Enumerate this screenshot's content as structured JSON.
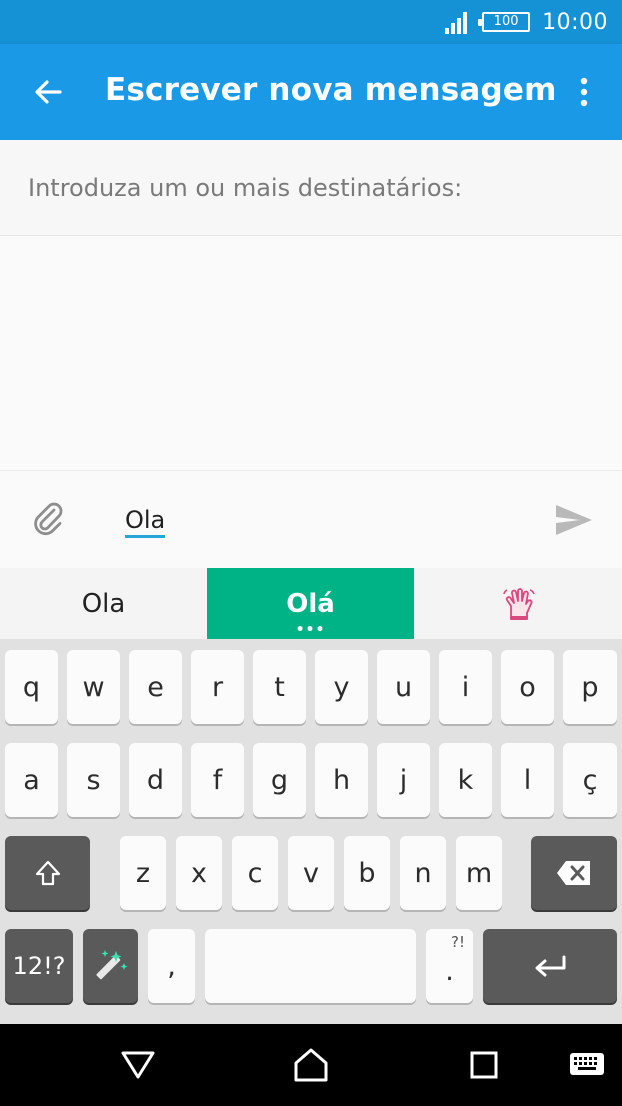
{
  "status_bar": {
    "battery": "100",
    "time": "10:00",
    "icons": [
      "signal-icon",
      "battery-icon"
    ]
  },
  "app_bar": {
    "title": "Escrever nova mensagem",
    "icons": [
      "back-arrow-icon",
      "more-vert-icon"
    ]
  },
  "recipients": {
    "placeholder": "Introduza um ou mais destinatários:"
  },
  "compose": {
    "message_text": "Ola",
    "icons": [
      "paperclip-icon",
      "send-icon"
    ]
  },
  "suggestions": {
    "items": [
      "Ola",
      "Olá"
    ],
    "icons": [
      "waving-hand-emoji-icon"
    ]
  },
  "keyboard": {
    "row1": [
      "q",
      "w",
      "e",
      "r",
      "t",
      "y",
      "u",
      "i",
      "o",
      "p"
    ],
    "row2": [
      "a",
      "s",
      "d",
      "f",
      "g",
      "h",
      "j",
      "k",
      "l",
      "ç"
    ],
    "row3": [
      "z",
      "x",
      "c",
      "v",
      "b",
      "n",
      "m"
    ],
    "symbols_key": "12!?",
    "comma_key": ",",
    "period_key": ".",
    "period_key_alt": "?!",
    "icons": [
      "shift-icon",
      "backspace-icon",
      "magic-wand-icon",
      "enter-icon"
    ]
  },
  "nav_bar": {
    "icons": [
      "back-triangle-icon",
      "home-icon",
      "recents-icon",
      "keyboard-icon"
    ]
  },
  "colors": {
    "status_bar": "#1591d6",
    "app_bar": "#1a9ae6",
    "suggestion_active": "#00b386",
    "underline": "#26a5d8"
  }
}
